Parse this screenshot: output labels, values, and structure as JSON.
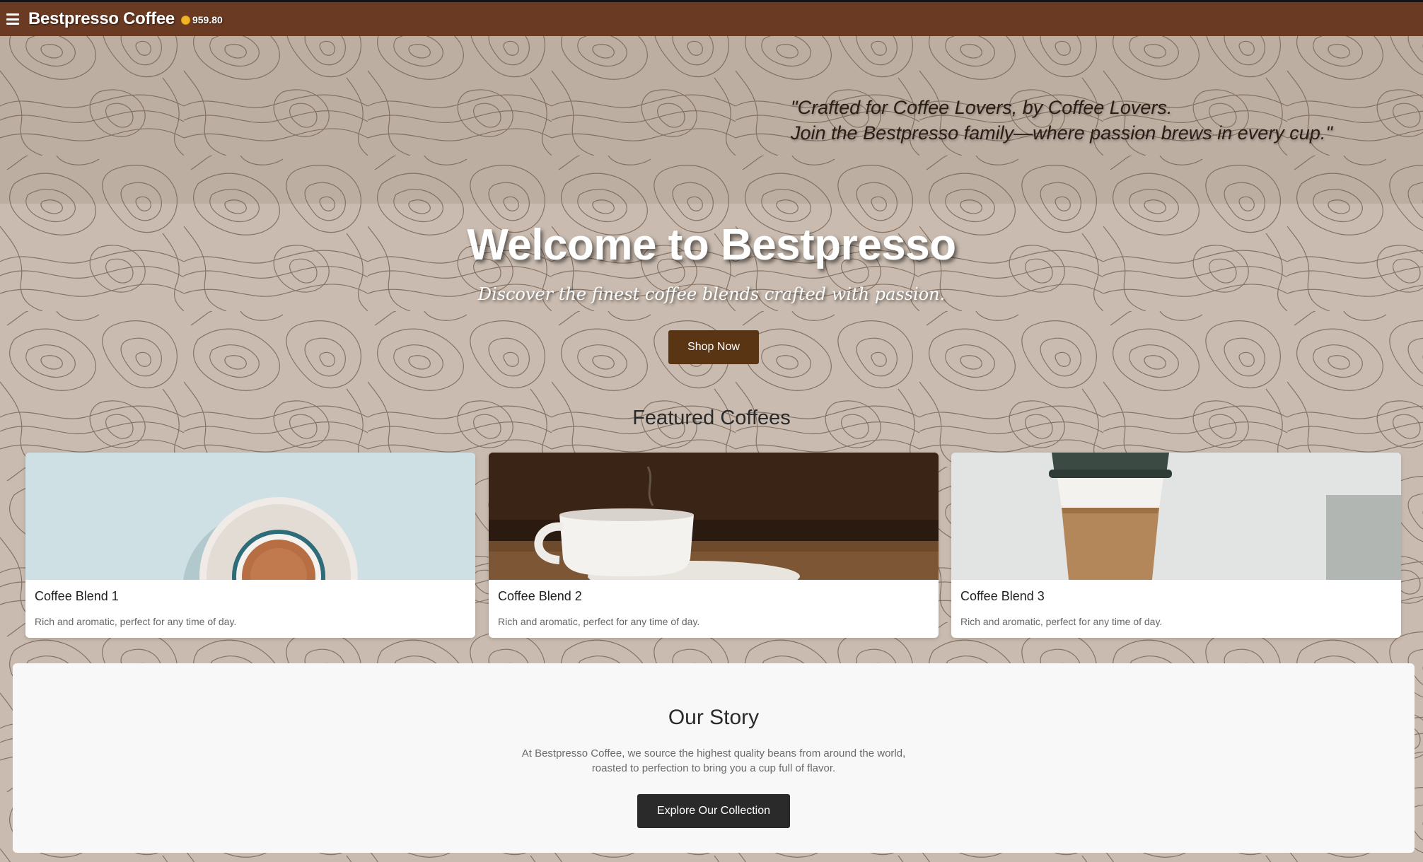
{
  "header": {
    "brand": "Bestpresso Coffee",
    "coin_balance": "959.80",
    "menu_icon": "hamburger-menu-icon",
    "coin_icon": "coin-icon"
  },
  "quote": {
    "line1": "\"Crafted for Coffee Lovers, by Coffee Lovers.",
    "line2": "Join the Bestpresso family—where passion brews in every cup.\""
  },
  "hero": {
    "title": "Welcome to Bestpresso",
    "subtitle": "Discover the finest coffee blends crafted with passion.",
    "button_label": "Shop Now"
  },
  "featured": {
    "title": "Featured Coffees",
    "cards": [
      {
        "title": "Coffee Blend 1",
        "description": "Rich and aromatic, perfect for any time of day.",
        "image": "espresso-cup-top-view"
      },
      {
        "title": "Coffee Blend 2",
        "description": "Rich and aromatic, perfect for any time of day.",
        "image": "white-cup-on-wood"
      },
      {
        "title": "Coffee Blend 3",
        "description": "Rich and aromatic, perfect for any time of day.",
        "image": "takeaway-cup"
      }
    ]
  },
  "story": {
    "title": "Our Story",
    "text": "At Bestpresso Coffee, we source the highest quality beans from around the world, roasted to perfection to bring you a cup full of flavor.",
    "button_label": "Explore Our Collection"
  },
  "colors": {
    "navbar": "#6b3a22",
    "background": "#c9bbaf",
    "shop_button": "#5a3514",
    "explore_button": "#2a2a2a",
    "coin": "#f0b429"
  }
}
